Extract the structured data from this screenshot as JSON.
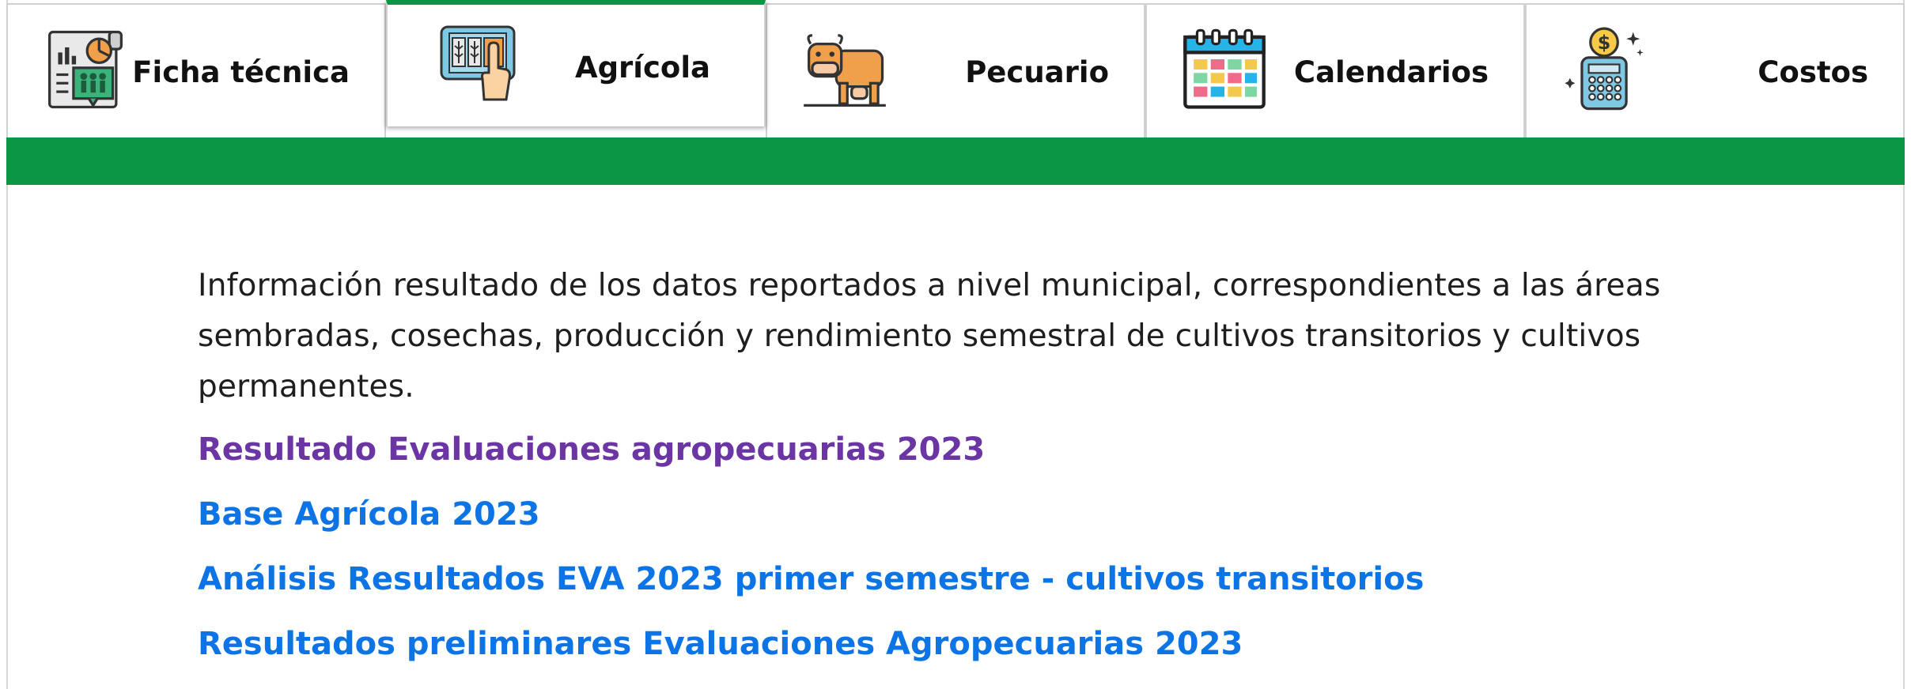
{
  "tabs": [
    {
      "label": "Ficha técnica",
      "icon": "report-chart-icon",
      "active": false
    },
    {
      "label": "Agrícola",
      "icon": "tablet-crops-hand-icon",
      "active": true
    },
    {
      "label": "Pecuario",
      "icon": "cow-icon",
      "active": false
    },
    {
      "label": "Calendarios",
      "icon": "calendar-icon",
      "active": false
    },
    {
      "label": "Costos",
      "icon": "calculator-dollar-icon",
      "active": false
    }
  ],
  "colors": {
    "accent_green": "#0a9645",
    "link_blue": "#0d74e6",
    "link_visited": "#6b35a3"
  },
  "content": {
    "description": "Información resultado de los datos reportados a nivel municipal, correspondientes a las áreas sembradas, cosechas, producción y rendimiento semestral de cultivos transitorios y cultivos permanentes.",
    "links": [
      {
        "label": "Resultado Evaluaciones agropecuarias 2023",
        "visited": true
      },
      {
        "label": "Base Agrícola 2023",
        "visited": false
      },
      {
        "label": "Análisis Resultados EVA 2023 primer semestre - cultivos transitorios",
        "visited": false
      },
      {
        "label": "Resultados preliminares Evaluaciones Agropecuarias 2023",
        "visited": false
      }
    ]
  }
}
